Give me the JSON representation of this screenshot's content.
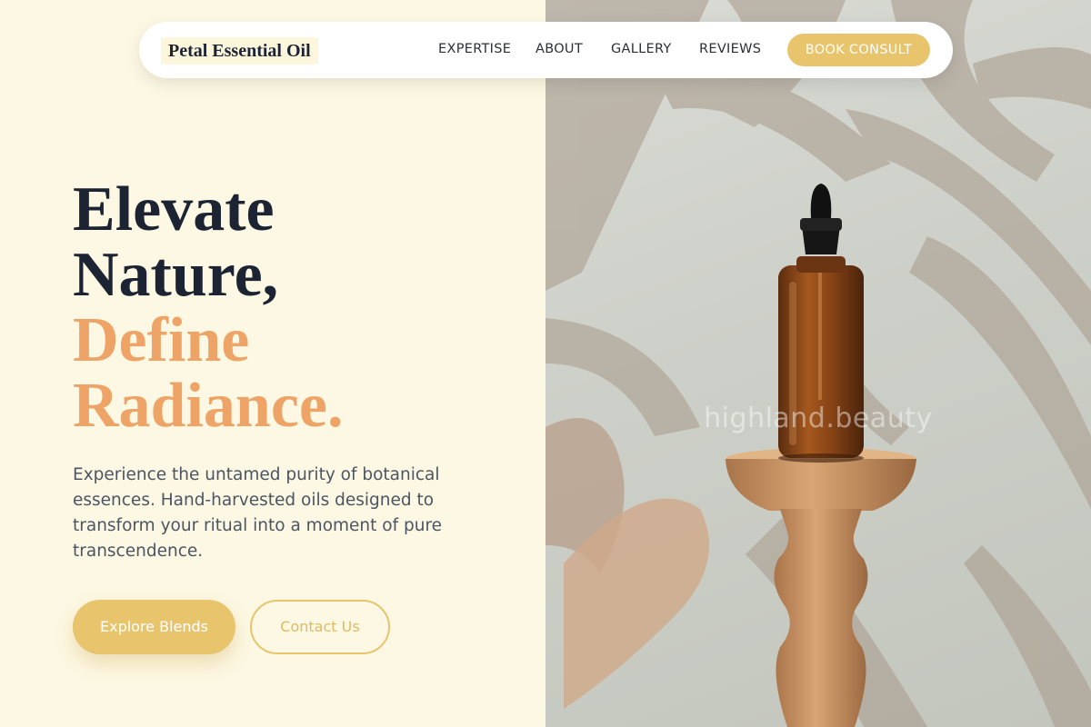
{
  "navbar": {
    "brand": "Petal Essential Oil",
    "links": [
      "EXPERTISE",
      "ABOUT",
      "GALLERY",
      "REVIEWS"
    ],
    "cta": "BOOK CONSULT"
  },
  "hero": {
    "headline_line1": "Elevate",
    "headline_line2": "Nature,",
    "headline_line3": "Define",
    "headline_line4": "Radiance.",
    "lead": "Experience the untamed purity of botanical essences. Hand-harvested oils designed to transform your ritual into a moment of pure transcendence.",
    "primary_button": "Explore Blends",
    "secondary_button": "Contact Us"
  },
  "photo": {
    "watermark": "highland.beauty",
    "subject": "amber dropper bottle on wooden pedestal"
  },
  "colors": {
    "background": "#fdf8e3",
    "accent_gold": "#e8c46d",
    "accent_peach": "#eea466",
    "heading_dark": "#1c2433"
  }
}
